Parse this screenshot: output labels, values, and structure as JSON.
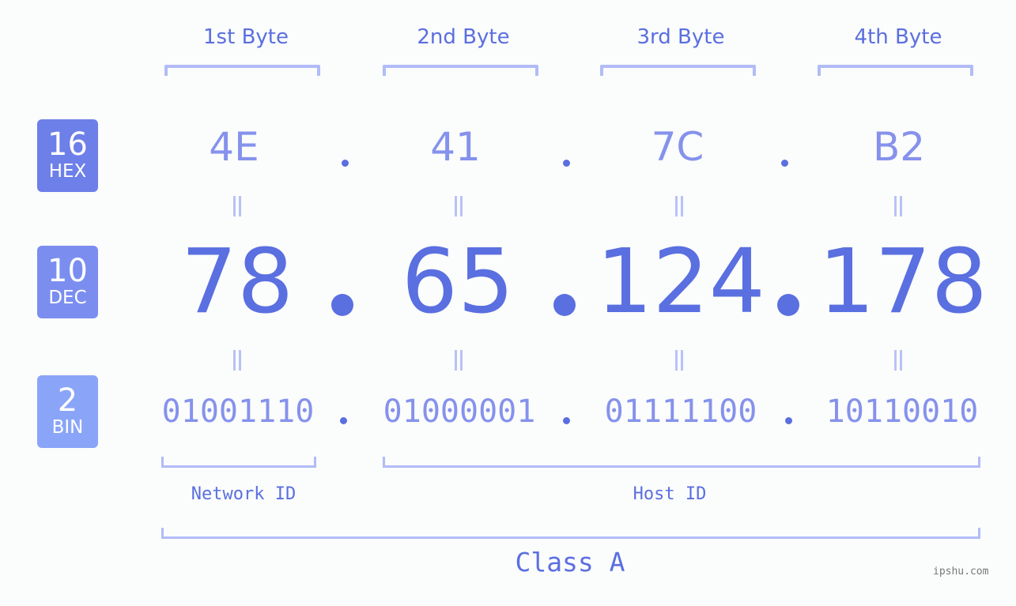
{
  "bytes": [
    {
      "label": "1st Byte",
      "hex": "4E",
      "dec": "78",
      "bin": "01001110"
    },
    {
      "label": "2nd Byte",
      "hex": "41",
      "dec": "65",
      "bin": "01000001"
    },
    {
      "label": "3rd Byte",
      "hex": "7C",
      "dec": "124",
      "bin": "01111100"
    },
    {
      "label": "4th Byte",
      "hex": "B2",
      "dec": "178",
      "bin": "10110010"
    }
  ],
  "badges": {
    "hex": {
      "base": "16",
      "name": "HEX",
      "color": "#6d7fe8"
    },
    "dec": {
      "base": "10",
      "name": "DEC",
      "color": "#7b8ef0"
    },
    "bin": {
      "base": "2",
      "name": "BIN",
      "color": "#8aa4f8"
    }
  },
  "separator": ".",
  "parts": {
    "network": "Network ID",
    "host": "Host ID"
  },
  "class_label": "Class A",
  "watermark": "ipshu.com",
  "colors": {
    "accent": "#5a6fe0",
    "light": "#8592ec",
    "bracket": "#b1bcf7"
  }
}
